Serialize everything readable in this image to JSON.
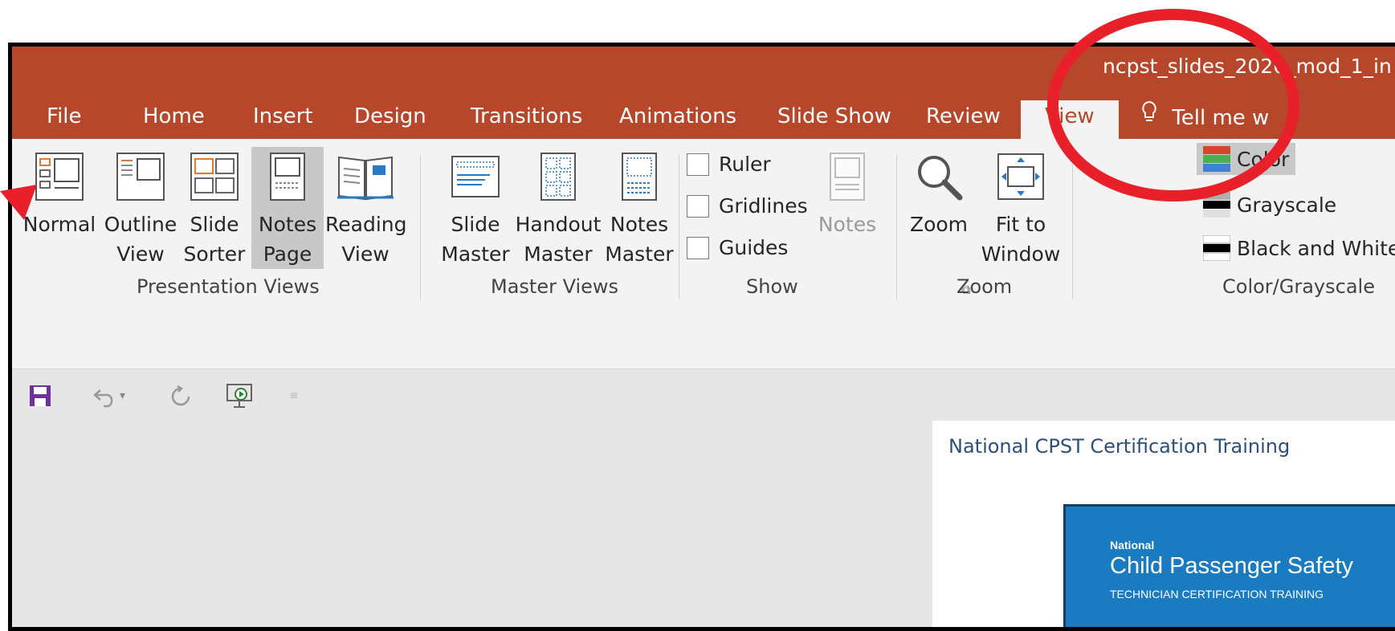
{
  "window": {
    "title": "ncpst_slides_2020_mod_1_in"
  },
  "tabs": [
    {
      "label": "File"
    },
    {
      "label": "Home"
    },
    {
      "label": "Insert"
    },
    {
      "label": "Design"
    },
    {
      "label": "Transitions"
    },
    {
      "label": "Animations"
    },
    {
      "label": "Slide Show"
    },
    {
      "label": "Review"
    },
    {
      "label": "View",
      "active": true
    },
    {
      "label": "Tell me w"
    }
  ],
  "ribbon": {
    "presentation_views": {
      "label": "Presentation Views",
      "normal": {
        "line1": "Normal",
        "line2": ""
      },
      "outline_view": {
        "line1": "Outline",
        "line2": "View"
      },
      "slide_sorter": {
        "line1": "Slide",
        "line2": "Sorter"
      },
      "notes_page": {
        "line1": "Notes",
        "line2": "Page",
        "selected": true
      },
      "reading_view": {
        "line1": "Reading",
        "line2": "View"
      }
    },
    "master_views": {
      "label": "Master Views",
      "slide_master": {
        "line1": "Slide",
        "line2": "Master"
      },
      "handout_master": {
        "line1": "Handout",
        "line2": "Master"
      },
      "notes_master": {
        "line1": "Notes",
        "line2": "Master"
      }
    },
    "show": {
      "label": "Show",
      "ruler": {
        "label": "Ruler",
        "checked": false
      },
      "gridlines": {
        "label": "Gridlines",
        "checked": false
      },
      "guides": {
        "label": "Guides",
        "checked": false
      },
      "notes": {
        "label": "Notes",
        "disabled": true
      }
    },
    "zoom": {
      "label": "Zoom",
      "zoom_button": {
        "line1": "Zoom",
        "line2": ""
      },
      "fit_to_window": {
        "line1": "Fit to",
        "line2": "Window"
      }
    },
    "color_grayscale": {
      "label": "Color/Grayscale",
      "color": "Color",
      "grayscale": "Grayscale",
      "black_and_white": "Black and White"
    }
  },
  "slide": {
    "header": "National CPST Certification Training",
    "brand_line1": "National",
    "brand_line2": "Child Passenger Safety",
    "brand_line3": "TECHNICIAN CERTIFICATION TRAINING"
  },
  "annotation": {
    "circle_color": "#e8202a",
    "arrow_color": "#e8202a"
  },
  "colors": {
    "accent": "#b7472a",
    "ribbon_bg": "#f3f3f3"
  }
}
